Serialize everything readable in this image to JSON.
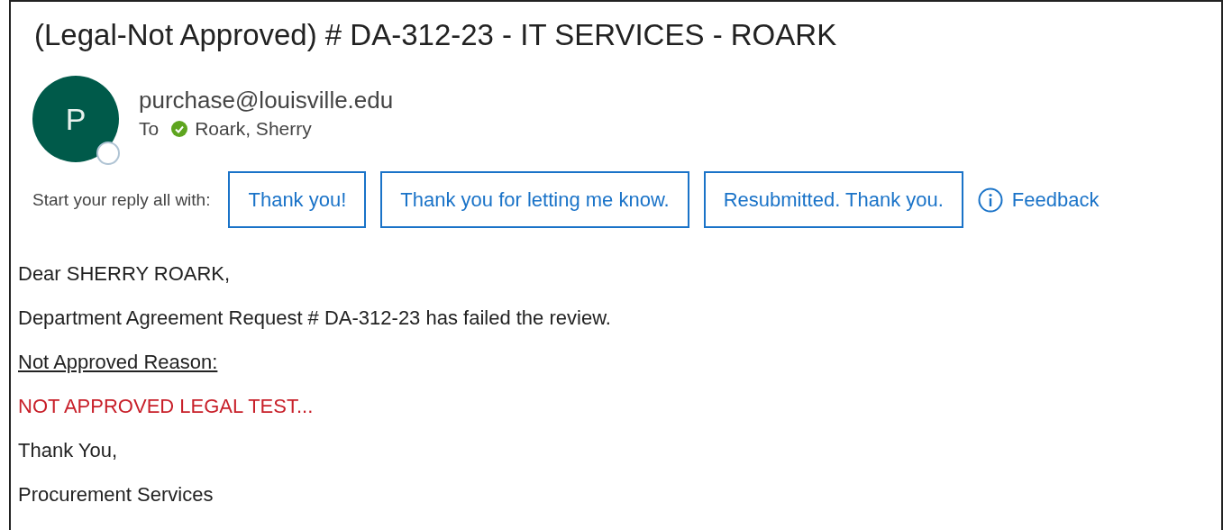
{
  "subject": "(Legal-Not Approved) # DA-312-23 - IT SERVICES - ROARK",
  "sender": {
    "initial": "P",
    "address": "purchase@louisville.edu"
  },
  "recipients": {
    "label": "To",
    "names": [
      "Roark, Sherry"
    ]
  },
  "quick_replies": {
    "label": "Start your reply all with:",
    "options": [
      "Thank you!",
      "Thank you for letting me know.",
      "Resubmitted. Thank you."
    ],
    "feedback": "Feedback"
  },
  "body": [
    {
      "kind": "plain",
      "text": "Dear SHERRY ROARK,"
    },
    {
      "kind": "plain",
      "text": "Department Agreement Request # DA-312-23 has failed the review."
    },
    {
      "kind": "underline",
      "text": "Not Approved Reason:"
    },
    {
      "kind": "alert",
      "text": "NOT APPROVED LEGAL TEST..."
    },
    {
      "kind": "plain",
      "text": "Thank You,"
    },
    {
      "kind": "plain",
      "text": "Procurement Services"
    }
  ]
}
